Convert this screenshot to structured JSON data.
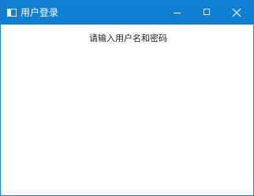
{
  "window": {
    "title": "用户登录",
    "prompt": "请输入用户名和密码"
  },
  "icons": {
    "app": "window-icon",
    "minimize": "minimize-icon",
    "maximize": "maximize-icon",
    "close": "close-icon"
  },
  "colors": {
    "titlebar": "#0f7fd4",
    "border": "#1c7fd0",
    "background": "#ffffff",
    "text": "#222222",
    "titlebar_text": "#ffffff"
  }
}
